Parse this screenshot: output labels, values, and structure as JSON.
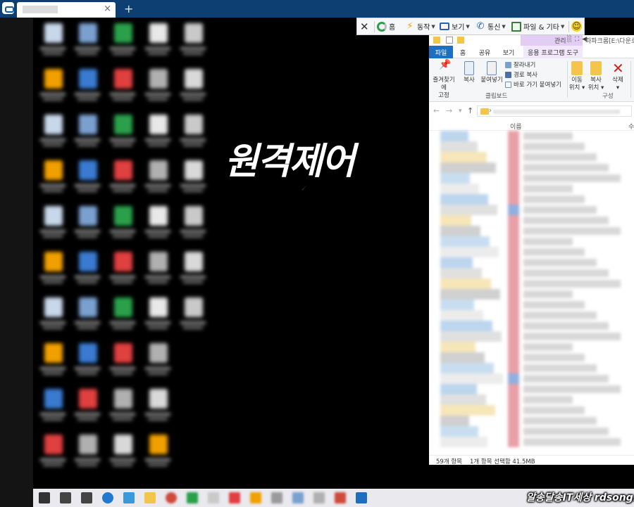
{
  "overlay_text": "원격제어",
  "remote_toolbar": {
    "items": [
      {
        "label": "홈",
        "icon": "home-icon"
      },
      {
        "label": "동작",
        "icon": "lightning-icon"
      },
      {
        "label": "보기",
        "icon": "monitor-icon"
      },
      {
        "label": "통신",
        "icon": "phone-icon"
      },
      {
        "label": "파일 & 기타",
        "icon": "file-transfer-icon"
      }
    ],
    "close_glyph": "✕",
    "smiley_glyph": "☺",
    "caret": "▼"
  },
  "explorer": {
    "manage_label": "관리",
    "window_title": "파파크롬[E:\\다운로드]",
    "tabs": [
      "파일",
      "홈",
      "공유",
      "보기",
      "응용 프로그램 도구"
    ],
    "ribbon": {
      "pin_label_1": "즐겨찾기에",
      "pin_label_2": "고정",
      "copy_label": "복사",
      "paste_label": "붙여넣기",
      "cut_label": "잘라내기",
      "copy_path_label": "경로 복사",
      "paste_shortcut_label": "바로 가기 붙여넣기",
      "clipboard_group": "클립보드",
      "move_to_1": "이동",
      "move_to_2": "위치",
      "copy_to_1": "복사",
      "copy_to_2": "위치",
      "delete_label": "삭제",
      "organize_group": "구성"
    },
    "nav": {
      "back": "←",
      "forward": "→",
      "up": "↑",
      "chevron": "›"
    },
    "columns": {
      "name": "이름",
      "size": "수"
    },
    "status": {
      "count": "59개 항목",
      "selection": "1개 항목 선택함 41.5MB"
    }
  },
  "brand": "알송달송IT세상 rdsong.com",
  "tab_new": "+",
  "tab_close": "×",
  "colors": {
    "tabbar": "#0e3f73",
    "ribbon_file_tab": "#1f6fc0",
    "manage_tab": "#e3cdf5",
    "taskbar": "#e9e9ee"
  }
}
